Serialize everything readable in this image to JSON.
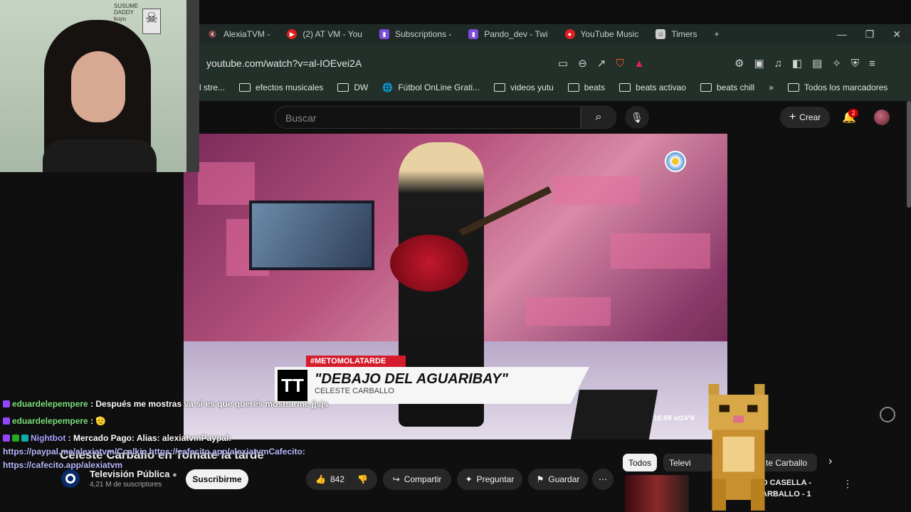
{
  "browser": {
    "tabs": [
      {
        "label": "AlexiaTVM -",
        "icon": "muted-speaker-icon"
      },
      {
        "label": "(2) AT VM - You",
        "icon": "youtube-icon"
      },
      {
        "label": "Subscriptions -",
        "icon": "twitch-icon"
      },
      {
        "label": "Pando_dev - Twi",
        "icon": "twitch-icon"
      },
      {
        "label": "YouTube Music",
        "icon": "youtube-music-icon"
      },
      {
        "label": "Timers",
        "icon": "timers-icon"
      }
    ],
    "new_tab": "+",
    "url": "youtube.com/watch?v=al-IOEvei2A",
    "bookmarks": [
      {
        "label": "l stre..."
      },
      {
        "label": "efectos musicales"
      },
      {
        "label": "DW"
      },
      {
        "label": "Fútbol OnLine Grati..."
      },
      {
        "label": "videos yutu"
      },
      {
        "label": "beats"
      },
      {
        "label": "beats activao"
      },
      {
        "label": "beats chill"
      }
    ],
    "bookmarks_more": "»",
    "all_bookmarks": "Todos los marcadores"
  },
  "youtube": {
    "search_placeholder": "Buscar",
    "create_label": "Crear",
    "notification_count": "2",
    "video": {
      "hashtag": "#METOMOLATARDE",
      "chyron_logo": "TT",
      "chyron_title": "\"DEBAJO DEL AGUARIBAY\"",
      "chyron_subtitle": "CELESTE CARBALLO",
      "clock": "16:09 st14°6"
    },
    "title": "Celeste Carballo en Tomate la tarde",
    "channel": {
      "name": "Televisión Pública",
      "subscribers": "4,21 M de suscriptores",
      "subscribe_label": "Suscribirme"
    },
    "actions": {
      "likes": "842",
      "share": "Compartir",
      "ask": "Preguntar",
      "save": "Guardar",
      "more": "⋯"
    },
    "chips": [
      "Todos",
      "Televi",
      "te Carballo"
    ],
    "recommended": {
      "line1": "O CASELLA -",
      "line2": "ARBALLO - 1"
    }
  },
  "chat": [
    {
      "user": "eduardelepempere",
      "message": ": Después me mostras va si es que querés mostrarme jjsjs"
    },
    {
      "user": "eduardelepempere",
      "message": ": 🫡"
    },
    {
      "user": "Nightbot",
      "message": ": Mercado Pago: Alias: alexiatvmPaypal:"
    }
  ],
  "chat_links": {
    "line1": "https://paypal.me/alexiatvm/Ccalkic.https://cafecito.app/alexiatvmCafecito:",
    "line2": "https://cafecito.app/alexiatvm"
  },
  "webcam": {
    "poster_text": "SUSUME\nDADDY\nkuyu"
  },
  "colors": {
    "youtube_red": "#cc0000",
    "twitch_purple": "#9146ff",
    "chat_user_green": "#7de07d"
  }
}
